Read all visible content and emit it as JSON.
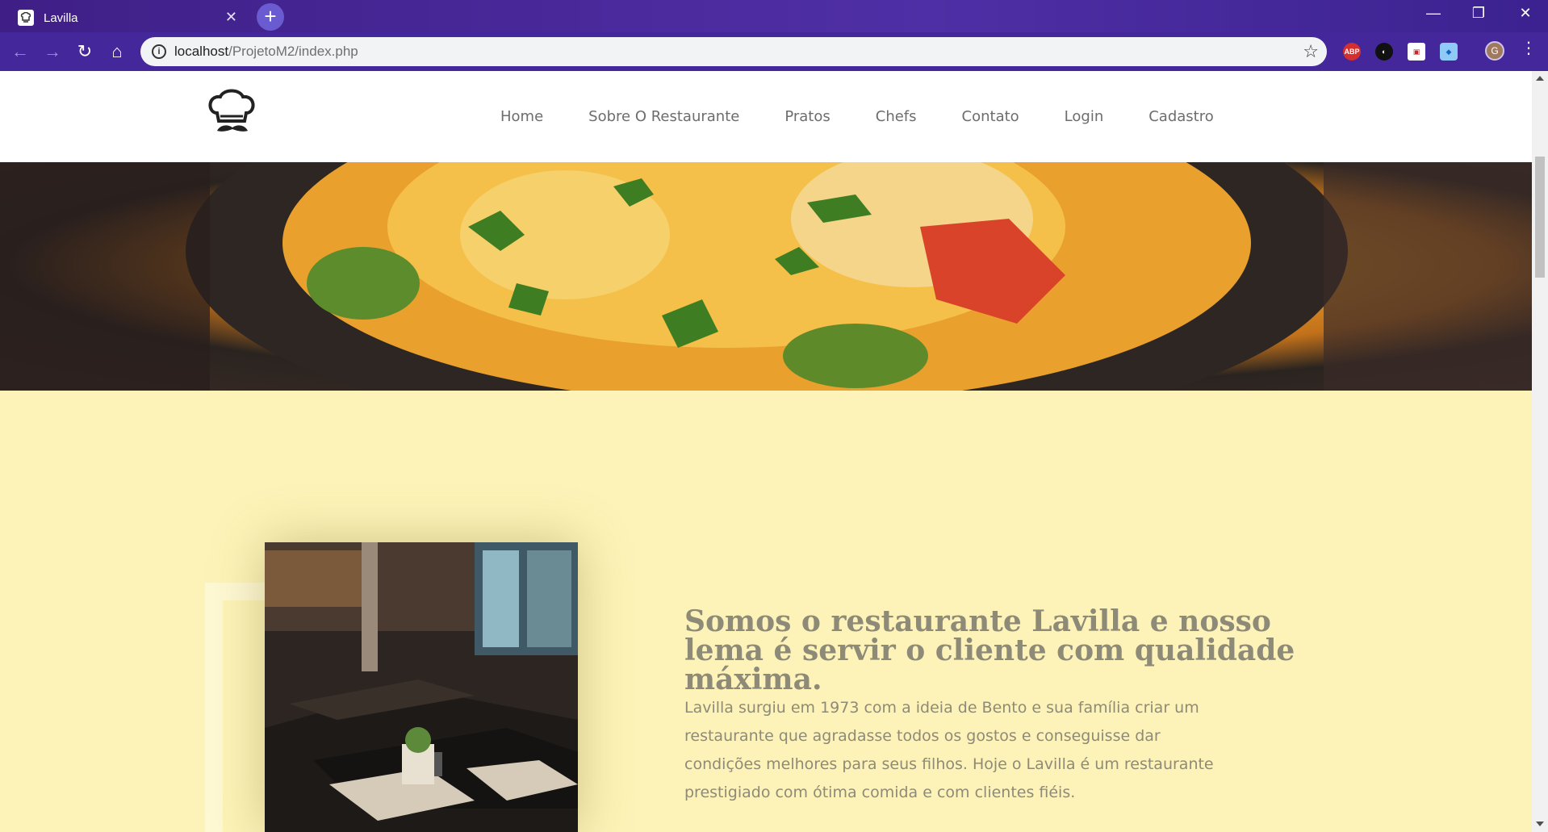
{
  "browser": {
    "tab_title": "Lavilla",
    "tab_close": "✕",
    "new_tab": "+",
    "url_host": "localhost",
    "url_path": "/ProjetoM2/index.php",
    "profile_initial": "G",
    "extensions": [
      "ABP"
    ]
  },
  "site": {
    "nav": [
      "Home",
      "Sobre O Restaurante",
      "Pratos",
      "Chefs",
      "Contato",
      "Login",
      "Cadastro"
    ]
  },
  "about": {
    "title": "Somos o restaurante Lavilla e nosso lema é servir o cliente com qualidade máxima.",
    "text": "Lavilla surgiu em 1973 com a ideia de Bento e sua família criar um restaurante que agradasse todos os gostos e conseguisse dar condições melhores para seus filhos. Hoje o Lavilla é um restaurante prestigiado com ótima comida e com clientes fiéis."
  },
  "colors": {
    "chrome": "#44279a",
    "page_bg": "#fdf3b8",
    "nav_text": "#6d6d6d",
    "body_text": "#8e8a78"
  }
}
